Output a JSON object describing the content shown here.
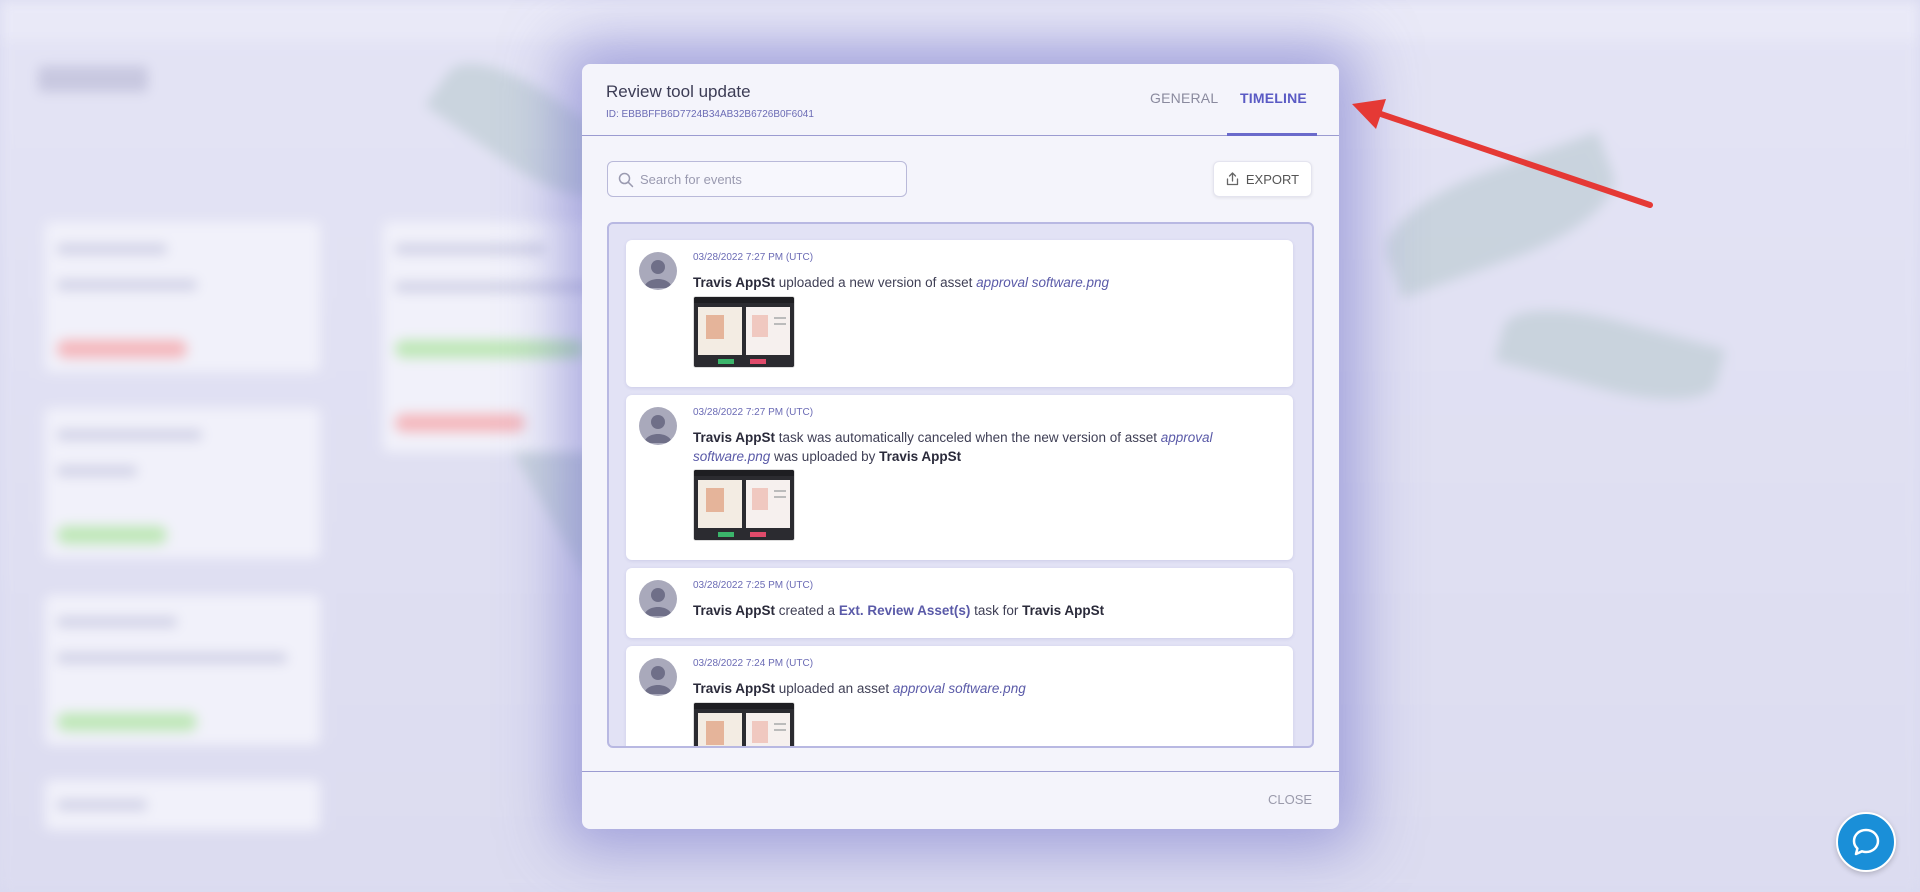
{
  "modal": {
    "title": "Review tool update",
    "id_text": "ID: EBBBFFB6D7724B34AB32B6726B0F6041",
    "tabs": [
      {
        "label": "GENERAL",
        "active": false
      },
      {
        "label": "TIMELINE",
        "active": true
      }
    ],
    "search": {
      "placeholder": "Search for events",
      "value": ""
    },
    "export_label": "EXPORT",
    "close_label": "CLOSE"
  },
  "events": [
    {
      "date": "03/28/2022 7:27 PM (UTC)",
      "actor": "Travis AppSt",
      "text_1": " uploaded a new version of asset ",
      "asset": "approval software.png",
      "has_thumbnail": true
    },
    {
      "date": "03/28/2022 7:27 PM (UTC)",
      "actor": "Travis AppSt",
      "text_1": " task was automatically canceled when the new version of asset ",
      "asset": "approval software.png",
      "text_2": " was uploaded by ",
      "actor_2": "Travis AppSt",
      "has_thumbnail": true
    },
    {
      "date": "03/28/2022 7:25 PM (UTC)",
      "actor": "Travis AppSt",
      "text_1": " created a ",
      "task": "Ext. Review Asset(s)",
      "text_2": " task for ",
      "actor_2": "Travis AppSt",
      "has_thumbnail": false
    },
    {
      "date": "03/28/2022 7:24 PM (UTC)",
      "actor": "Travis AppSt",
      "text_1": " uploaded an asset ",
      "asset": "approval software.png",
      "has_thumbnail": true
    }
  ],
  "colors": {
    "accent": "#5a5ac4",
    "annotation_arrow": "#e53935",
    "chat_button": "#1a8fd8"
  },
  "icons": {
    "search": "search-icon",
    "export": "export-icon",
    "chat": "chat-icon"
  }
}
